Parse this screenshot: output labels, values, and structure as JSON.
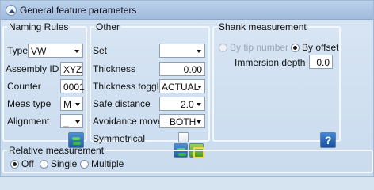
{
  "header": {
    "title": "General feature parameters",
    "collapse_icon": "collapse-chevron-up-icon"
  },
  "naming_rules": {
    "legend": "Naming Rules",
    "type": {
      "label": "Type",
      "value": "VW"
    },
    "assembly_id": {
      "label": "Assembly ID",
      "value": "XYZ"
    },
    "counter": {
      "label": "Counter",
      "value": "0001"
    },
    "meas_type": {
      "label": "Meas type",
      "value": "M"
    },
    "alignment": {
      "label": "Alignment",
      "value": "_"
    },
    "refresh_icon": "refresh-icon"
  },
  "other": {
    "legend": "Other",
    "set": {
      "label": "Set",
      "value": ""
    },
    "thickness": {
      "label": "Thickness",
      "value": "0.00"
    },
    "thickness_toggle": {
      "label": "Thickness toggle",
      "value": "ACTUAL"
    },
    "safe_distance": {
      "label": "Safe distance",
      "value": "2.0"
    },
    "avoidance_move": {
      "label": "Avoidance move",
      "value": "BOTH"
    },
    "symmetrical": {
      "label": "Symmetrical",
      "checked": false
    },
    "refresh_icon": "refresh-icon",
    "export_icon": "export-icon"
  },
  "shank": {
    "legend": "Shank measurement",
    "by_tip_number": {
      "label": "By tip number",
      "checked": false,
      "enabled": false
    },
    "by_offset": {
      "label": "By offset",
      "checked": true
    },
    "immersion_depth": {
      "label": "Immersion depth",
      "value": "0.0"
    },
    "help_icon": "help-icon"
  },
  "relative": {
    "legend": "Relative measurement",
    "options": [
      {
        "label": "Off",
        "checked": true
      },
      {
        "label": "Single",
        "checked": false
      },
      {
        "label": "Multiple",
        "checked": false
      }
    ]
  }
}
